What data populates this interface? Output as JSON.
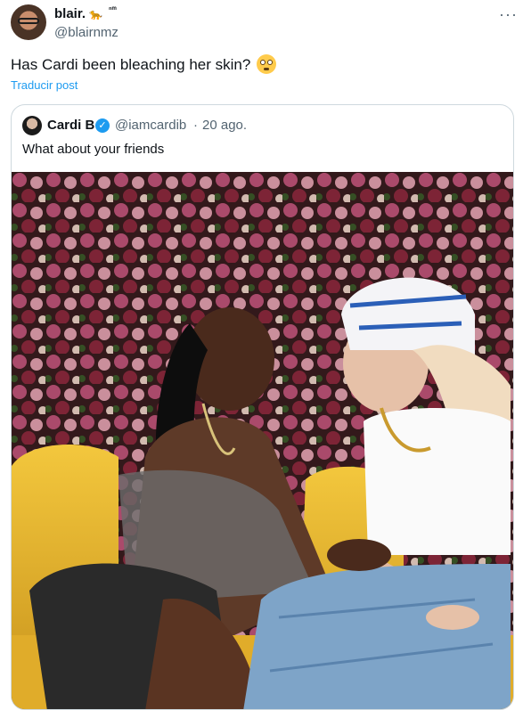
{
  "tweet": {
    "display_name": "blair.",
    "name_emoji": "🐆",
    "name_suffix": "ⁿᵐ",
    "handle": "@blairnmz",
    "more_label": "···",
    "text": "Has Cardi been bleaching her skin?",
    "emoji": "flushed-face",
    "translate_label": "Traducir post"
  },
  "quote": {
    "display_name": "Cardi B",
    "verified": "✓",
    "handle": "@iamcardib",
    "separator": "·",
    "date": "20 ago.",
    "text": "What about your friends"
  },
  "colors": {
    "link": "#1d9bf0",
    "secondary_text": "#536471",
    "border": "#cfd9de",
    "chair": "#e8b92c",
    "flower_wall": "#b5456a"
  }
}
